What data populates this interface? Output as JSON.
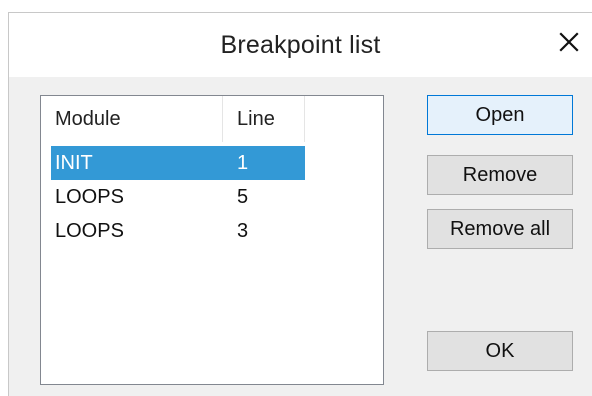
{
  "window": {
    "title": "Breakpoint list",
    "close_icon": "close-icon"
  },
  "list": {
    "columns": [
      "Module",
      "Line"
    ],
    "rows": [
      {
        "module": "INIT",
        "line": "1",
        "selected": true
      },
      {
        "module": "LOOPS",
        "line": "5",
        "selected": false
      },
      {
        "module": "LOOPS",
        "line": "3",
        "selected": false
      }
    ]
  },
  "buttons": {
    "open": "Open",
    "remove": "Remove",
    "remove_all": "Remove all",
    "ok": "OK"
  },
  "colors": {
    "selection": "#3399d6",
    "default_button_border": "#0078d7",
    "dialog_bg": "#f0f0f0"
  }
}
